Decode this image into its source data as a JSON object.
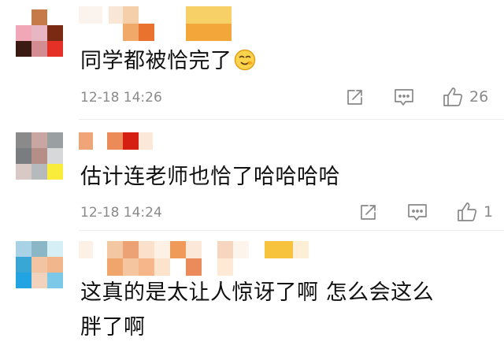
{
  "comments": [
    {
      "text": "同学都被恰完了",
      "emoji": "smiling-face-emoji",
      "timestamp": "12-18 14:26",
      "likes": "26"
    },
    {
      "text": "估计连老师也恰了哈哈哈哈",
      "timestamp": "12-18 14:24",
      "likes": "1"
    },
    {
      "text_line1": "这真的是太让人惊讶了啊 怎么会这么",
      "text_line2": "胖了啊"
    }
  ],
  "icons": {
    "share": "share-icon",
    "reply": "comment-icon",
    "like": "thumbs-up-icon"
  },
  "colors": {
    "text": "#111111",
    "meta": "#8a8a8a",
    "icon": "#888888",
    "divider": "#ececec"
  }
}
